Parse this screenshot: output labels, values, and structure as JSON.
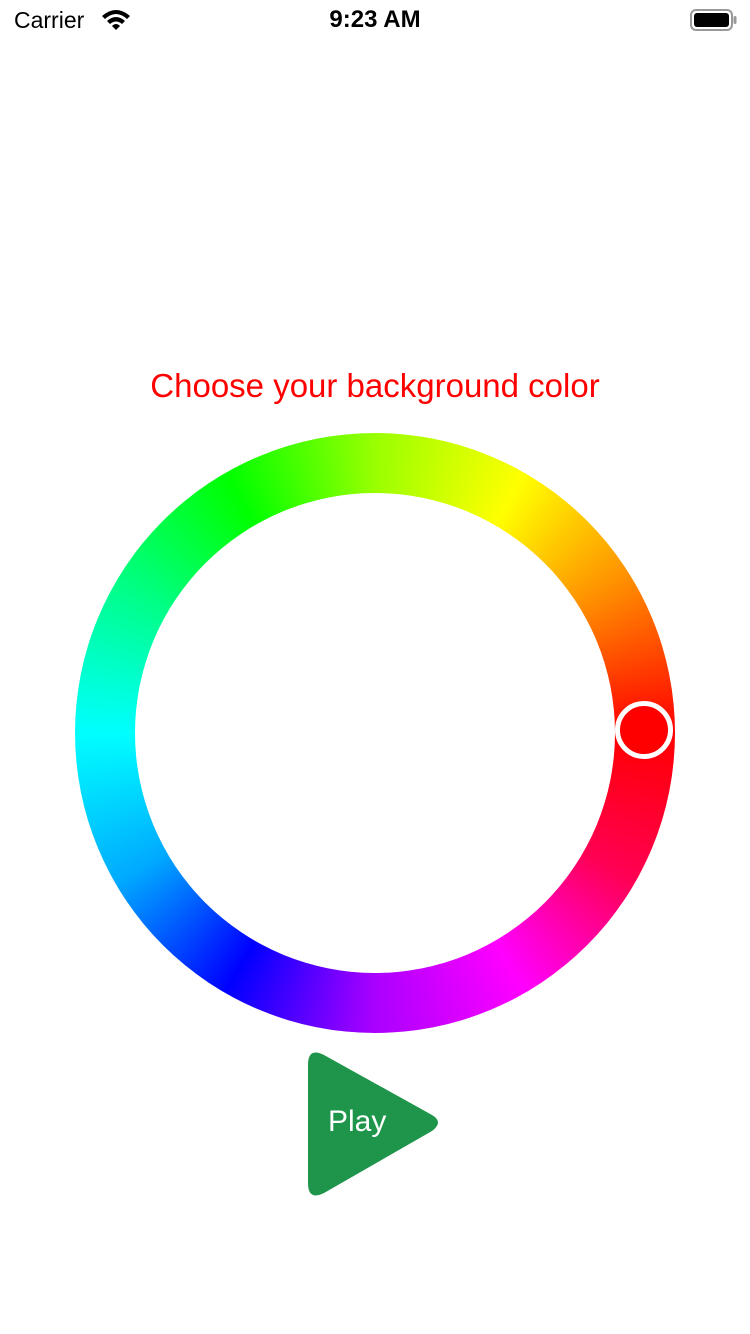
{
  "status_bar": {
    "carrier": "Carrier",
    "time": "9:23 AM",
    "icons": [
      "wifi-icon",
      "battery-icon"
    ]
  },
  "title": {
    "text": "Choose your background color",
    "color": "#ff0000"
  },
  "color_wheel": {
    "selected_color": "#ff0000",
    "selected_hue_degrees": 0
  },
  "play_button": {
    "label": "Play",
    "color": "#1e954b"
  }
}
